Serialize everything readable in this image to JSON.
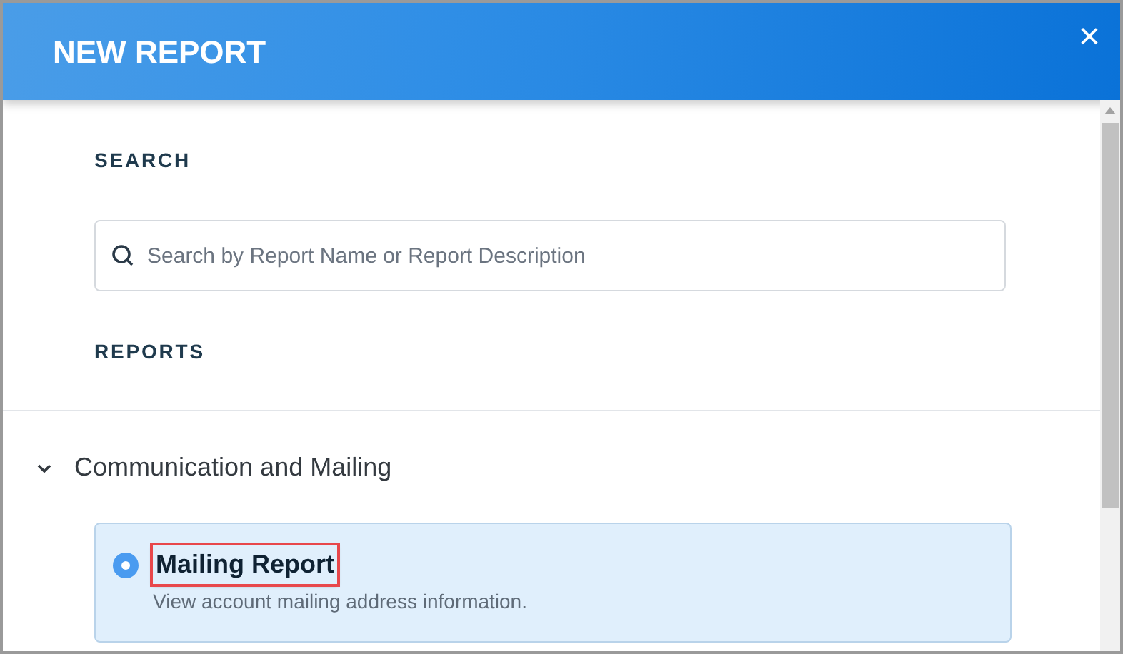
{
  "dialog": {
    "title": "NEW REPORT",
    "close": "×"
  },
  "search": {
    "label": "SEARCH",
    "placeholder": "Search by Report Name or Report Description"
  },
  "reports_label": "REPORTS",
  "groups": [
    {
      "name": "Communication and Mailing",
      "expanded": true,
      "reports": [
        {
          "name": "Mailing Report",
          "description": "View account mailing address information.",
          "selected": true,
          "highlighted": true
        }
      ]
    }
  ]
}
